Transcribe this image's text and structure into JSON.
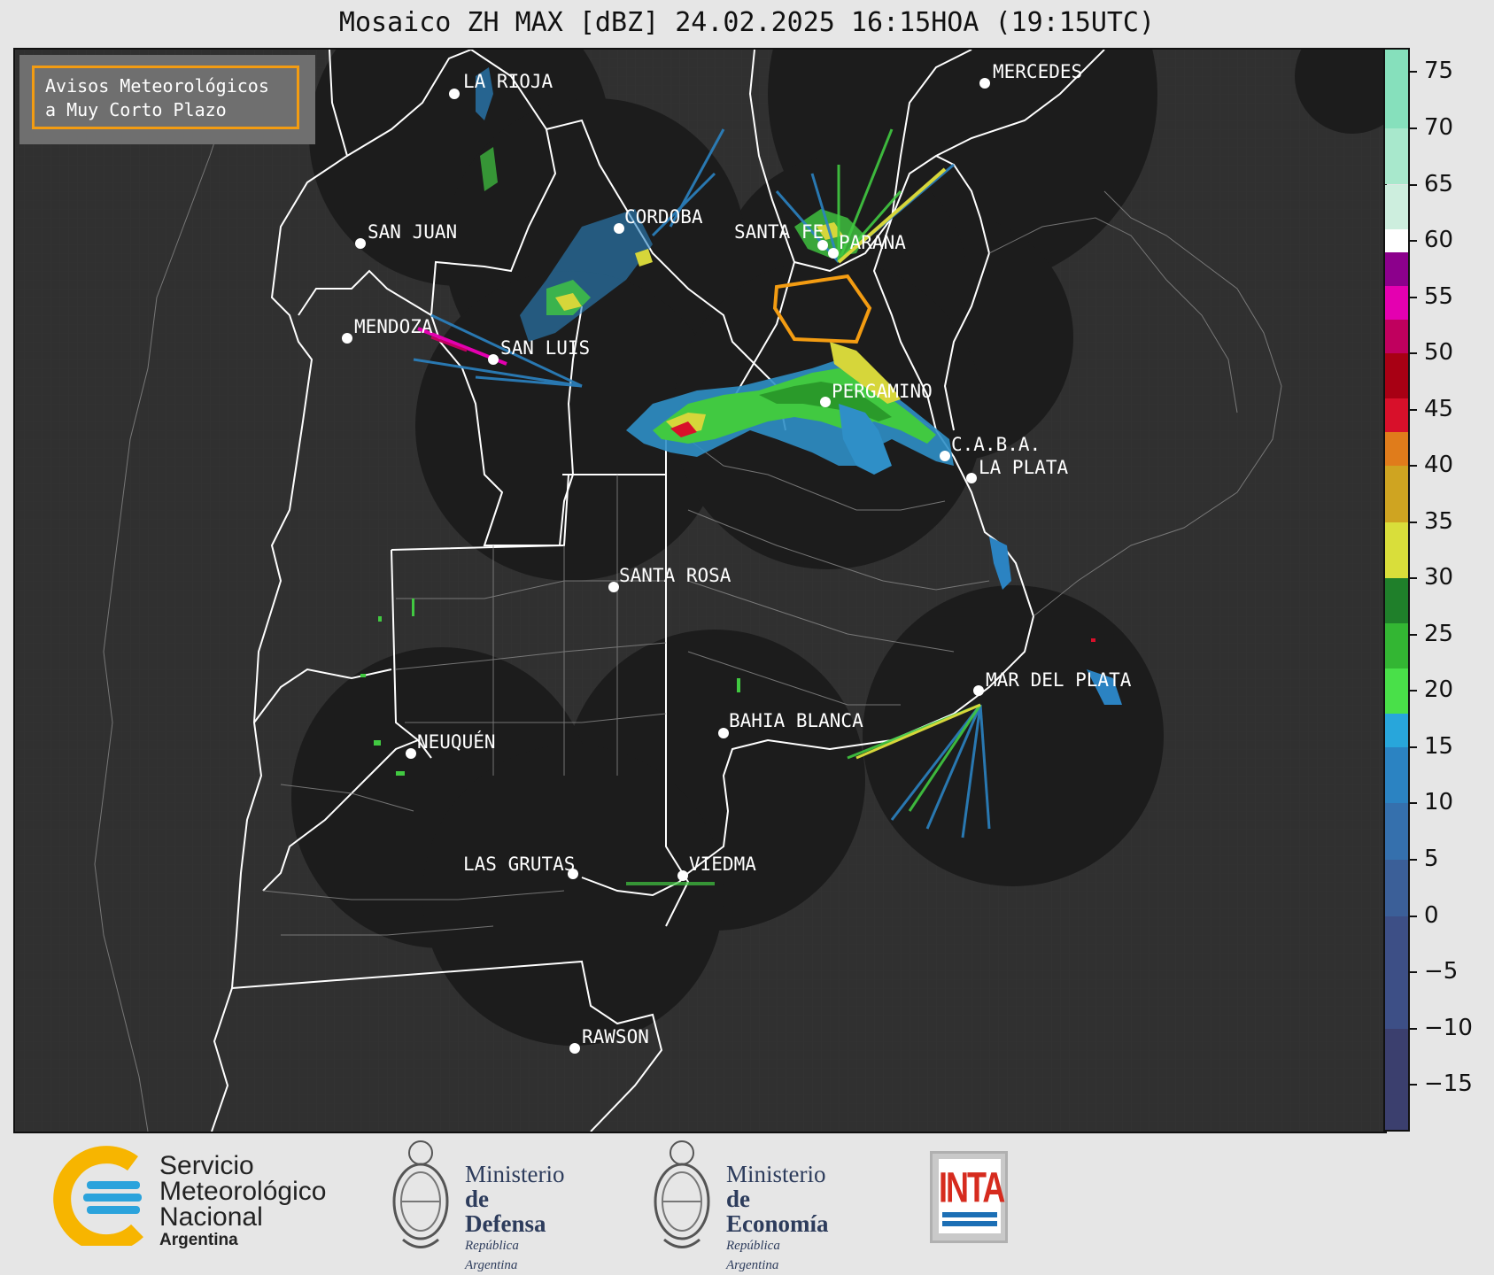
{
  "title": "Mosaico ZH MAX [dBZ] 24.02.2025 16:15HOA (19:15UTC)",
  "notice": {
    "line1": "Avisos Meteorológicos",
    "line2": "a Muy Corto Plazo",
    "border_color": "#f39c12"
  },
  "cities": {
    "la_rioja": "LA RIOJA",
    "mercedes": "MERCEDES",
    "san_juan": "SAN JUAN",
    "cordoba": "CORDOBA",
    "santa_fe": "SANTA FE",
    "parana": "PARANA",
    "mendoza": "MENDOZA",
    "san_luis": "SAN LUIS",
    "pergamino": "PERGAMINO",
    "caba": "C.A.B.A.",
    "la_plata": "LA PLATA",
    "santa_rosa": "SANTA ROSA",
    "mar_del_plata": "MAR DEL PLATA",
    "bahia_blanca": "BAHIA BLANCA",
    "neuquen": "NEUQUÉN",
    "las_grutas": "LAS GRUTAS",
    "viedma": "VIEDMA",
    "rawson": "RAWSON"
  },
  "colorbar": {
    "unit": "dBZ",
    "range": [
      -19,
      77
    ],
    "ticks": [
      "75",
      "70",
      "65",
      "60",
      "55",
      "50",
      "45",
      "40",
      "35",
      "30",
      "25",
      "20",
      "15",
      "10",
      "5",
      "0",
      "−5",
      "−10",
      "−15"
    ],
    "tick_values": [
      75,
      70,
      65,
      60,
      55,
      50,
      45,
      40,
      35,
      30,
      25,
      20,
      15,
      10,
      5,
      0,
      -5,
      -10,
      -15
    ],
    "stops": [
      {
        "from": -19,
        "to": -10,
        "color": "#3b3f6e"
      },
      {
        "from": -10,
        "to": 0,
        "color": "#3d4f86"
      },
      {
        "from": 0,
        "to": 5,
        "color": "#3b5f98"
      },
      {
        "from": 5,
        "to": 10,
        "color": "#3570ad"
      },
      {
        "from": 10,
        "to": 15,
        "color": "#2b83c2"
      },
      {
        "from": 15,
        "to": 18,
        "color": "#28a6db"
      },
      {
        "from": 18,
        "to": 22,
        "color": "#49e049"
      },
      {
        "from": 22,
        "to": 26,
        "color": "#33b633"
      },
      {
        "from": 26,
        "to": 30,
        "color": "#1f7f2a"
      },
      {
        "from": 30,
        "to": 35,
        "color": "#d9de3a"
      },
      {
        "from": 35,
        "to": 40,
        "color": "#cfa421"
      },
      {
        "from": 40,
        "to": 43,
        "color": "#e07c1b"
      },
      {
        "from": 43,
        "to": 46,
        "color": "#d8102a"
      },
      {
        "from": 46,
        "to": 50,
        "color": "#a80014"
      },
      {
        "from": 50,
        "to": 53,
        "color": "#c0005e"
      },
      {
        "from": 53,
        "to": 56,
        "color": "#e400b0"
      },
      {
        "from": 56,
        "to": 59,
        "color": "#8c008c"
      },
      {
        "from": 59,
        "to": 61,
        "color": "#ffffff"
      },
      {
        "from": 61,
        "to": 65,
        "color": "#cdeede"
      },
      {
        "from": 65,
        "to": 70,
        "color": "#a8e8cc"
      },
      {
        "from": 70,
        "to": 77,
        "color": "#86e0bc"
      }
    ]
  },
  "footer": {
    "smn": {
      "line1": "Servicio",
      "line2": "Meteorológico",
      "line3": "Nacional",
      "line4": "Argentina"
    },
    "defensa": {
      "line1": "Ministerio",
      "line2": "de Defensa",
      "line3": "República Argentina"
    },
    "economia": {
      "line1": "Ministerio",
      "line2": "de Economía",
      "line3": "República Argentina"
    },
    "inta": "INTA"
  },
  "colors": {
    "background": "#e6e6e6",
    "map_land": "#303030",
    "radar_disk": "#1c1c1c",
    "warning": "#f39c12"
  }
}
